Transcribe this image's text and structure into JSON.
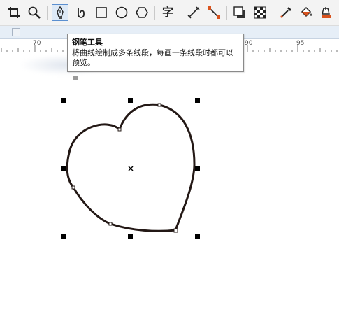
{
  "toolbar": {
    "tools": [
      {
        "name": "crop-tool",
        "icon": "crop-icon"
      },
      {
        "name": "zoom-tool",
        "icon": "magnifier-icon"
      },
      {
        "name": "pen-tool",
        "icon": "pen-nib-icon",
        "active": true
      },
      {
        "name": "bspline-tool",
        "icon": "spiral-hook-icon"
      },
      {
        "name": "rectangle-tool",
        "icon": "rectangle-icon"
      },
      {
        "name": "ellipse-tool",
        "icon": "ellipse-icon"
      },
      {
        "name": "polygon-tool",
        "icon": "hexagon-icon"
      },
      {
        "name": "text-tool",
        "icon": "text-icon",
        "glyph": "字"
      },
      {
        "name": "dimension-tool",
        "icon": "parallel-dimension-icon"
      },
      {
        "name": "connector-tool",
        "icon": "connector-icon"
      },
      {
        "name": "drop-shadow-tool",
        "icon": "drop-shadow-icon"
      },
      {
        "name": "transparency-tool",
        "icon": "checkerboard-icon"
      },
      {
        "name": "eyedropper-tool",
        "icon": "eyedropper-icon"
      },
      {
        "name": "interactive-fill-tool",
        "icon": "paint-bucket-icon"
      },
      {
        "name": "smart-fill-tool",
        "icon": "smart-fill-icon"
      }
    ],
    "accent_color": "#d9531e",
    "active_color": "#5b8fd0"
  },
  "ruler": {
    "labels": [
      "70",
      "90",
      "95"
    ]
  },
  "tooltip": {
    "title": "钢笔工具",
    "body": "将曲线绘制成多条线段，每画一条线段时都可以预览。"
  },
  "canvas": {
    "shape": "heart-curve",
    "stroke_color": "#231815",
    "selection_handle_color": "#000000"
  }
}
